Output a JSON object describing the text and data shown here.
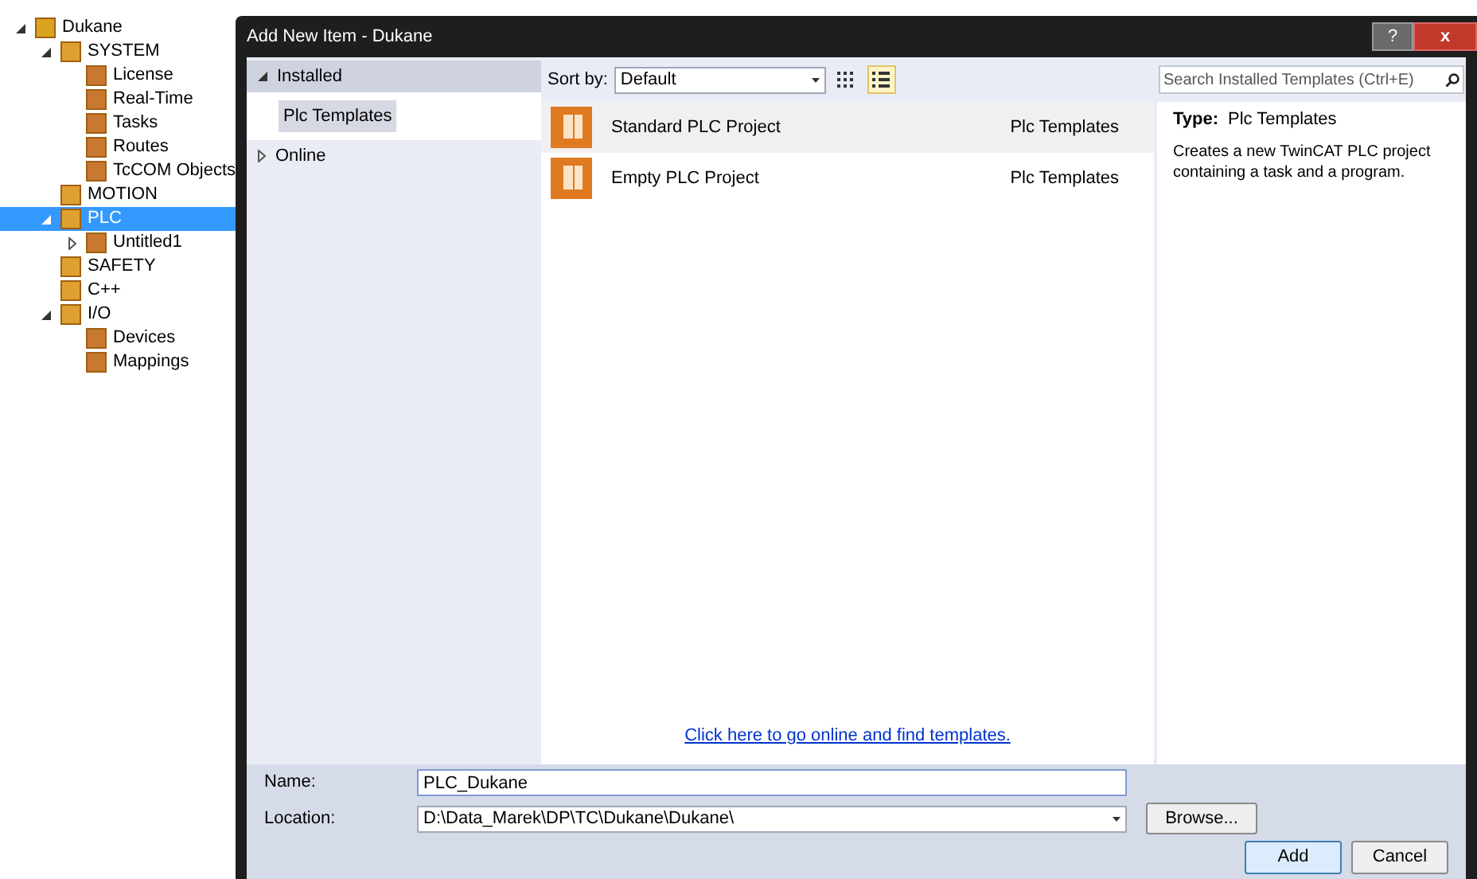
{
  "tree": [
    {
      "label": "Dukane",
      "expanded": true,
      "selected": false,
      "children": [
        {
          "label": "SYSTEM",
          "expanded": true,
          "selected": false,
          "children": [
            {
              "label": "License",
              "selected": false
            },
            {
              "label": "Real-Time",
              "selected": false
            },
            {
              "label": "Tasks",
              "selected": false
            },
            {
              "label": "Routes",
              "selected": false
            },
            {
              "label": "TcCOM Objects",
              "selected": false
            }
          ]
        },
        {
          "label": "MOTION",
          "selected": false
        },
        {
          "label": "PLC",
          "expanded": true,
          "selected": true,
          "children": [
            {
              "label": "Untitled1",
              "expanded": false,
              "selected": false
            }
          ]
        },
        {
          "label": "SAFETY",
          "selected": false
        },
        {
          "label": "C++",
          "selected": false
        },
        {
          "label": "I/O",
          "expanded": true,
          "selected": false,
          "children": [
            {
              "label": "Devices",
              "selected": false
            },
            {
              "label": "Mappings",
              "selected": false
            }
          ]
        }
      ]
    }
  ],
  "dialog": {
    "title": "Add New Item - Dukane",
    "help": "?",
    "close": "x"
  },
  "categories": [
    {
      "label": "Installed",
      "expanded": true,
      "children": [
        {
          "label": "Plc Templates",
          "selected": true
        }
      ]
    },
    {
      "label": "Online",
      "expanded": false
    }
  ],
  "sort": {
    "label": "Sort by:",
    "value": "Default"
  },
  "view_modes": [
    {
      "kind": "grid",
      "selected": false
    },
    {
      "kind": "list",
      "selected": true
    }
  ],
  "search": {
    "placeholder": "Search Installed Templates (Ctrl+E)"
  },
  "templates": [
    {
      "name": "Standard PLC Project",
      "category": "Plc Templates",
      "selected": true
    },
    {
      "name": "Empty PLC Project",
      "category": "Plc Templates",
      "selected": false
    }
  ],
  "details": {
    "type_label": "Type:",
    "type_value": "Plc Templates",
    "description": "Creates a new TwinCAT PLC project containing a task and a program."
  },
  "online_link": "Click here to go online and find templates.",
  "form": {
    "name_label": "Name:",
    "name_value": "PLC_Dukane",
    "location_label": "Location:",
    "location_value": "D:\\Data_Marek\\DP\\TC\\Dukane\\Dukane\\",
    "browse": "Browse..."
  },
  "buttons": [
    {
      "label": "Add",
      "default": true
    },
    {
      "label": "Cancel",
      "default": false
    }
  ]
}
